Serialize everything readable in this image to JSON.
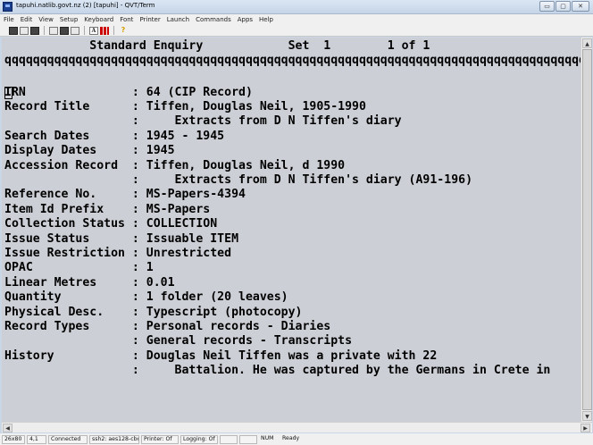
{
  "window": {
    "title": "tapuhi.natlib.govt.nz (2) [tapuhi] - QVT/Term",
    "buttons": [
      "▭",
      "▢",
      "✕"
    ]
  },
  "menu": [
    "File",
    "Edit",
    "View",
    "Setup",
    "Keyboard",
    "Font",
    "Printer",
    "Launch",
    "Commands",
    "Apps",
    "Help"
  ],
  "toolbar": [
    "print-icon",
    "save-icon",
    "disk-icon",
    "copy-icon",
    "paste-icon",
    "printer-icon",
    "font-icon",
    "color-bars-icon",
    "help-icon"
  ],
  "toolbar_font_label": "A",
  "toolbar_help_label": "?",
  "terminal": {
    "header": "            Standard Enquiry            Set  1        1 of 1",
    "rule": "qqqqqqqqqqqqqqqqqqqqqqqqqqqqqqqqqqqqqqqqqqqqqqqqqqqqqqqqqqqqqqqqqqqqqqqqqqqqqqqqqqq",
    "rows": [
      "IRN               : 64 (CIP Record)",
      "Record Title      : Tiffen, Douglas Neil, 1905-1990",
      "                  :     Extracts from D N Tiffen's diary",
      "Search Dates      : 1945 - 1945",
      "Display Dates     : 1945",
      "Accession Record  : Tiffen, Douglas Neil, d 1990",
      "                  :     Extracts from D N Tiffen's diary (A91-196)",
      "Reference No.     : MS-Papers-4394",
      "Item Id Prefix    : MS-Papers",
      "Collection Status : COLLECTION",
      "Issue Status      : Issuable ITEM",
      "Issue Restriction : Unrestricted",
      "OPAC              : 1",
      "Linear Metres     : 0.01",
      "Quantity          : 1 folder (20 leaves)",
      "Physical Desc.    : Typescript (photocopy)",
      "Record Types      : Personal records - Diaries",
      "                  : General records - Transcripts",
      "History           : Douglas Neil Tiffen was a private with 22",
      "                  :     Battalion. He was captured by the Germans in Crete in"
    ]
  },
  "scrollbars": {
    "up": "▲",
    "down": "▼",
    "left": "◀",
    "right": "▶"
  },
  "status": [
    "26x80",
    "4,1",
    "Connected",
    "ssh2: aes128-cbc",
    "Printer: Of",
    "Logging: Of",
    "",
    "",
    "NUM",
    "Ready"
  ]
}
